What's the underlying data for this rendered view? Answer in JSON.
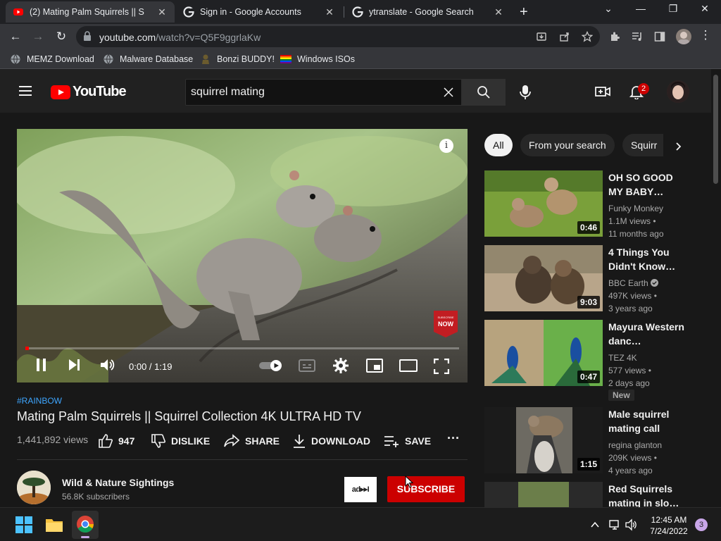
{
  "browser": {
    "tabs": [
      {
        "title": "(2) Mating Palm Squirrels || S",
        "active": true
      },
      {
        "title": "Sign in - Google Accounts",
        "active": false
      },
      {
        "title": "ytranslate - Google Search",
        "active": false
      }
    ],
    "url_host": "youtube.com",
    "url_path": "/watch?v=Q5F9ggrlaKw",
    "bookmarks": [
      "MEMZ Download",
      "Malware Database",
      "Bonzi BUDDY!",
      "Windows ISOs"
    ]
  },
  "header": {
    "logo": "YouTube",
    "search_query": "squirrel mating",
    "notification_count": "2"
  },
  "player": {
    "time": "0:00 / 1:19",
    "progress_fraction": 0.0,
    "overlay_text_top": "SUBSCRIBE",
    "overlay_text_main": "NOW"
  },
  "video": {
    "hashtag": "#RAINBOW",
    "title": "Mating Palm Squirrels || Squirrel Collection 4K ULTRA HD TV",
    "views": "1,441,892 views",
    "likes": "947",
    "dislike_label": "DISLIKE",
    "share_label": "SHARE",
    "download_label": "DOWNLOAD",
    "save_label": "SAVE"
  },
  "channel": {
    "name": "Wild & Nature Sightings",
    "subscribers": "56.8K subscribers",
    "subscribe_label": "SUBSCRIBE",
    "adblock_label": "ad▸▸I"
  },
  "chips": [
    "All",
    "From your search",
    "Squirr"
  ],
  "recommendations": [
    {
      "title": "OH SO GOOD MY BABY…",
      "channel": "Funky Monkey",
      "views": "1.1M views •",
      "age": "11 months ago",
      "duration": "0:46"
    },
    {
      "title": "4 Things You Didn't Know…",
      "channel": "BBC Earth",
      "views": "497K views •",
      "age": "3 years ago",
      "duration": "9:03"
    },
    {
      "title": "Mayura Western danc…",
      "channel": "TEZ 4K",
      "views": "577 views •",
      "age": "2 days ago",
      "duration": "0:47",
      "badge": "New"
    },
    {
      "title": "Male squirrel mating call",
      "channel": "regina glanton",
      "views": "209K views •",
      "age": "4 years ago",
      "duration": "1:15"
    },
    {
      "title": "Red Squirrels mating in slo…"
    }
  ],
  "taskbar": {
    "time": "12:45 AM",
    "date": "7/24/2022",
    "notifications": "3"
  }
}
